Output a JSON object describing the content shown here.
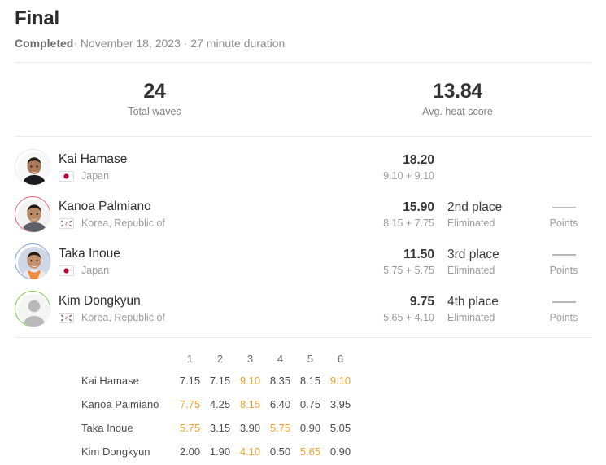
{
  "header": {
    "title": "Final",
    "status": "Completed",
    "separator": "·",
    "date": "November 18, 2023",
    "duration": "27 minute duration"
  },
  "stats": [
    {
      "value": "24",
      "label": "Total waves"
    },
    {
      "value": "13.84",
      "label": "Avg. heat score"
    }
  ],
  "athletes": [
    {
      "name": "Kai Hamase",
      "country": "Japan",
      "flag": "jp",
      "ring_color": "#e8e8e8",
      "avatar_type": "photo-kai",
      "total": "18.20",
      "breakdown": "9.10 + 9.10",
      "place": "",
      "status": "",
      "points": "",
      "points_label": ""
    },
    {
      "name": "Kanoa Palmiano",
      "country": "Korea, Republic of",
      "flag": "kr",
      "ring_color": "#e8616f",
      "avatar_type": "photo-kanoa",
      "total": "15.90",
      "breakdown": "8.15 + 7.75",
      "place": "2nd place",
      "status": "Eliminated",
      "points": "——",
      "points_label": "Points"
    },
    {
      "name": "Taka Inoue",
      "country": "Japan",
      "flag": "jp",
      "ring_color": "#7b9ed4",
      "avatar_type": "photo-taka",
      "total": "11.50",
      "breakdown": "5.75 + 5.75",
      "place": "3rd place",
      "status": "Eliminated",
      "points": "——",
      "points_label": "Points"
    },
    {
      "name": "Kim Dongkyun",
      "country": "Korea, Republic of",
      "flag": "kr",
      "ring_color": "#7ac943",
      "avatar_type": "placeholder",
      "total": "9.75",
      "breakdown": "5.65 + 4.10",
      "place": "4th place",
      "status": "Eliminated",
      "points": "——",
      "points_label": "Points"
    }
  ],
  "wave_table": {
    "columns": [
      "1",
      "2",
      "3",
      "4",
      "5",
      "6"
    ],
    "rows": [
      {
        "name": "Kai Hamase",
        "scores": [
          "7.15",
          "7.15",
          "9.10",
          "8.35",
          "8.15",
          "9.10"
        ],
        "counted": [
          false,
          false,
          true,
          false,
          false,
          true
        ]
      },
      {
        "name": "Kanoa Palmiano",
        "scores": [
          "7.75",
          "4.25",
          "8.15",
          "6.40",
          "0.75",
          "3.95"
        ],
        "counted": [
          true,
          false,
          true,
          false,
          false,
          false
        ]
      },
      {
        "name": "Taka Inoue",
        "scores": [
          "5.75",
          "3.15",
          "3.90",
          "5.75",
          "0.90",
          "5.05"
        ],
        "counted": [
          true,
          false,
          false,
          true,
          false,
          false
        ]
      },
      {
        "name": "Kim Dongkyun",
        "scores": [
          "2.00",
          "1.90",
          "4.10",
          "0.50",
          "5.65",
          "0.90"
        ],
        "counted": [
          false,
          false,
          true,
          false,
          true,
          false
        ]
      }
    ]
  },
  "colors": {
    "counted_score": "#f0a42a",
    "divider": "#e9e9e9",
    "text_primary": "#333333",
    "text_muted": "#9a9a9a"
  }
}
